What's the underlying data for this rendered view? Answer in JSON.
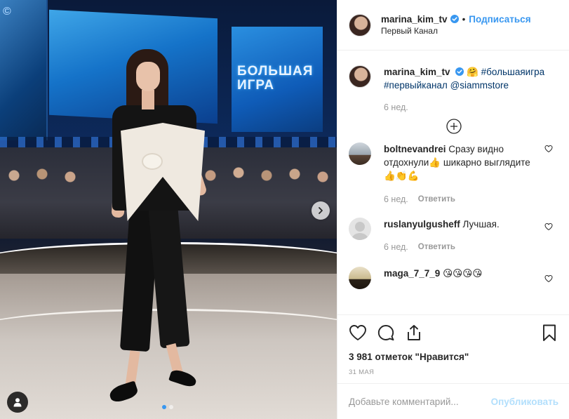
{
  "post": {
    "author": "marina_kim_tv",
    "follow_label": "Подписаться",
    "separator": "•",
    "location": "Первый Канал",
    "photo": {
      "screen_text_line1": "БОЛЬШАЯ",
      "screen_text_line2": "ИГРА",
      "slide_count": 2,
      "active_slide": 1
    }
  },
  "caption": {
    "author": "marina_kim_tv",
    "emoji": "🤗",
    "hashtag1": "#большаяигра",
    "hashtag2": "#первыйканал",
    "mention": "@siammstore",
    "time": "6 нед."
  },
  "comments": [
    {
      "author": "boltnevandrei",
      "text": "Сразу видно отдохнули👍 шикарно выглядите 👍👏💪",
      "time": "6 нед.",
      "reply": "Ответить"
    },
    {
      "author": "ruslanyulgusheff",
      "text": "Лучшая.",
      "time": "6 нед.",
      "reply": "Ответить"
    },
    {
      "author": "maga_7_7_9",
      "text": "😘😘😘😘",
      "time": "",
      "reply": ""
    }
  ],
  "stats": {
    "likes": "3 981 отметок \"Нравится\"",
    "date": "31 мая"
  },
  "compose": {
    "placeholder": "Добавьте комментарий...",
    "publish_label": "Опубликовать"
  },
  "icons": {
    "verified": "verified-badge-icon",
    "like": "heart-icon",
    "comment": "comment-bubble-icon",
    "share": "share-upload-icon",
    "save": "bookmark-icon",
    "load_more": "plus-circle-icon",
    "next": "chevron-right-icon",
    "tag": "user-tag-icon"
  },
  "colors": {
    "accent": "#3897f0",
    "link": "#003569",
    "muted": "#999999",
    "publish_disabled": "#b2dffc"
  }
}
